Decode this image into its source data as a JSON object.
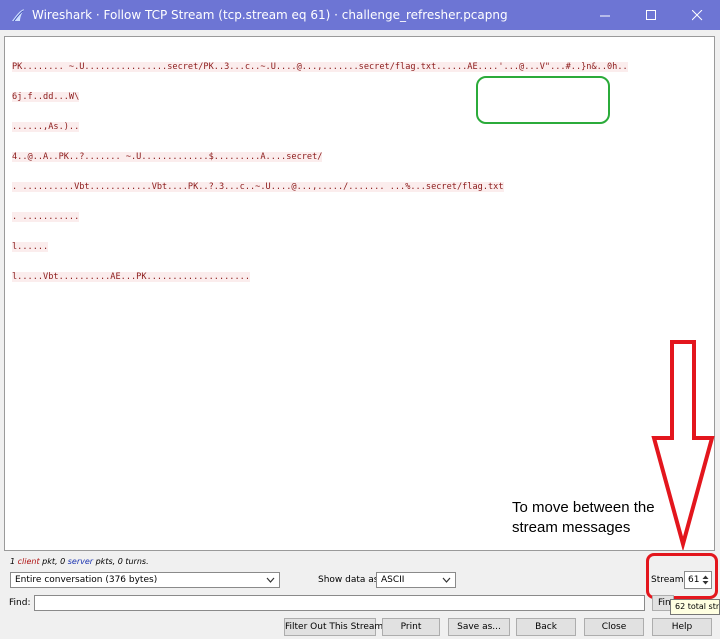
{
  "window": {
    "title": "Wireshark · Follow TCP Stream (tcp.stream eq 61) · challenge_refresher.pcapng",
    "icons": {
      "logo": "wireshark-fin-icon",
      "minimize": "minimize-icon",
      "maximize": "maximize-icon",
      "close": "close-icon"
    }
  },
  "stream": {
    "lines": [
      "PK........ ~.U................secret/PK..3...c..~.U....@...,.......secret/flag.txt......AE....'...@...V\"...#..}n&..0h..",
      "6j.f..dd...W\\",
      "......,As.)..",
      "4..@..A..PK..?....... ~.U.............$.........A....secret/",
      ". ..........Vbt............Vbt....PK..?.3...c..~.U....@...,...../....... ...%...secret/flag.txt",
      ". ...........",
      "l......",
      "l.....Vbt..........AE...PK...................."
    ]
  },
  "annotation": {
    "line1": "To move between the",
    "line2": "stream messages"
  },
  "status": {
    "client_count": "1",
    "client_word": "client",
    "mid": " pkt, 0 ",
    "server_word": "server",
    "tail": " pkts, 0 turns."
  },
  "controls": {
    "conversation_select": "Entire conversation (376 bytes)",
    "show_data_label": "Show data as",
    "show_data_value": "ASCII",
    "stream_label": "Stream",
    "stream_value": "61",
    "find_label": "Find:",
    "find_value": "",
    "find_button": "Fin",
    "tooltip": "62 total str"
  },
  "buttons": {
    "filter_out": "Filter Out This Stream",
    "print": "Print",
    "save_as": "Save as...",
    "back": "Back",
    "close": "Close",
    "help": "Help"
  },
  "colors": {
    "titlebar": "#6d75d4",
    "client_text": "#8b1a1a",
    "client_bg": "#fbeded",
    "annotation_green": "#2bab3a",
    "annotation_red": "#e3161d"
  }
}
